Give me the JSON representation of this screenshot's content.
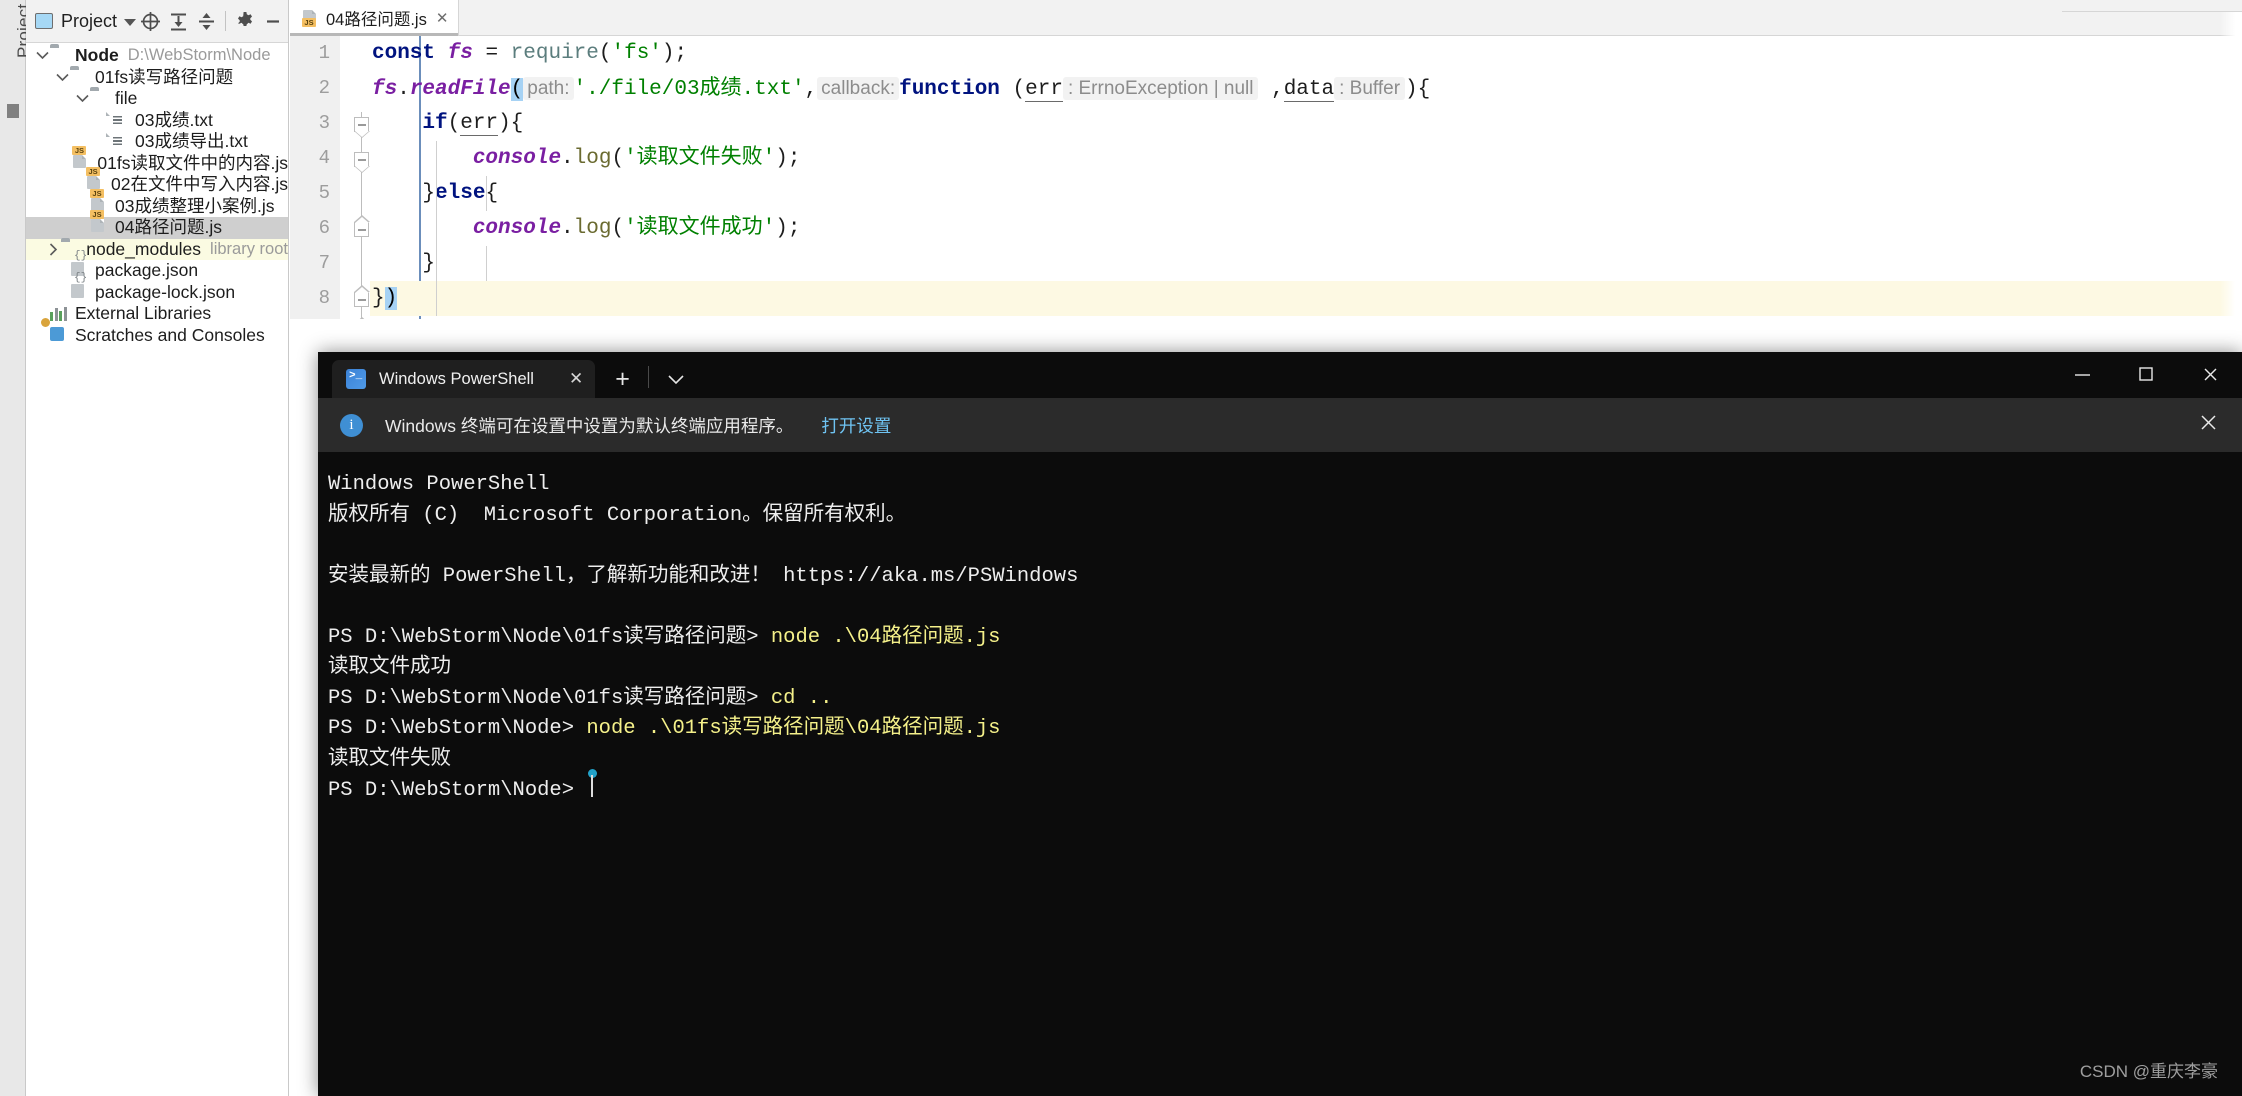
{
  "ide": {
    "vertical_tab_label": "Project",
    "project_panel": {
      "title": "Project",
      "toolbar": [
        {
          "name": "locate-icon",
          "glyph": "locate"
        },
        {
          "name": "expand-all-icon",
          "glyph": "expand-all"
        },
        {
          "name": "collapse-all-icon",
          "glyph": "collapse-all"
        },
        {
          "name": "gear-icon",
          "glyph": "gear"
        },
        {
          "name": "hide-icon",
          "glyph": "minus"
        }
      ],
      "tree": [
        {
          "label": "Node",
          "sub": "D:\\WebStorm\\Node",
          "icon": "folder",
          "twist": "down",
          "depth": 0,
          "bold": true,
          "state": "normal"
        },
        {
          "label": "01fs读写路径问题",
          "sub": "",
          "icon": "folder",
          "twist": "down",
          "depth": 1,
          "bold": false,
          "state": "normal"
        },
        {
          "label": "file",
          "sub": "",
          "icon": "folder",
          "twist": "down",
          "depth": 2,
          "bold": false,
          "state": "normal"
        },
        {
          "label": "03成绩.txt",
          "sub": "",
          "icon": "txt",
          "twist": "none",
          "depth": 3,
          "bold": false,
          "state": "normal"
        },
        {
          "label": "03成绩导出.txt",
          "sub": "",
          "icon": "txt",
          "twist": "none",
          "depth": 3,
          "bold": false,
          "state": "normal"
        },
        {
          "label": "01fs读取文件中的内容.js",
          "sub": "",
          "icon": "js",
          "twist": "none",
          "depth": 2,
          "bold": false,
          "state": "normal"
        },
        {
          "label": "02在文件中写入内容.js",
          "sub": "",
          "icon": "js",
          "twist": "none",
          "depth": 2,
          "bold": false,
          "state": "normal"
        },
        {
          "label": "03成绩整理小案例.js",
          "sub": "",
          "icon": "js",
          "twist": "none",
          "depth": 2,
          "bold": false,
          "state": "normal"
        },
        {
          "label": "04路径问题.js",
          "sub": "",
          "icon": "js",
          "twist": "none",
          "depth": 2,
          "bold": false,
          "state": "selected"
        },
        {
          "label": "node_modules",
          "sub": "library root",
          "icon": "folder",
          "twist": "right",
          "depth": 1,
          "bold": false,
          "state": "highlight"
        },
        {
          "label": "package.json",
          "sub": "",
          "icon": "json",
          "twist": "none",
          "depth": 1,
          "bold": false,
          "state": "normal"
        },
        {
          "label": "package-lock.json",
          "sub": "",
          "icon": "json",
          "twist": "none",
          "depth": 1,
          "bold": false,
          "state": "normal"
        },
        {
          "label": "External Libraries",
          "sub": "",
          "icon": "lib",
          "twist": "none",
          "depth": 0,
          "bold": false,
          "state": "normal"
        },
        {
          "label": "Scratches and Consoles",
          "sub": "",
          "icon": "scratch",
          "twist": "none",
          "depth": 0,
          "bold": false,
          "state": "normal"
        }
      ]
    },
    "editor": {
      "tab": {
        "label": "04路径问题.js",
        "close": "✕",
        "icon": "js-file-icon"
      },
      "line_numbers": [
        "1",
        "2",
        "3",
        "4",
        "5",
        "6",
        "7",
        "8"
      ],
      "code": {
        "l1": {
          "kw_const": "const",
          "var_fs": "fs",
          "eq": " = ",
          "require": "require",
          "open": "(",
          "str": "'fs'",
          "close": ");"
        },
        "l2": {
          "obj": "fs",
          "dot": ".",
          "method": "readFile",
          "paren_open": "(",
          "hint_path": "path:",
          "str_path": "'./file/03成绩.txt'",
          "comma": ",",
          "hint_callback": "callback:",
          "kw_function": "function",
          "sp_paren": " (",
          "param_err": "err",
          "type_err": ": ErrnoException | null",
          "comma2": " ,",
          "param_data": "data",
          "type_data": ": Buffer",
          "tail": "){"
        },
        "l3": {
          "kw_if": "if",
          "paren": "(",
          "param": "err",
          "close": "){"
        },
        "l4": {
          "obj": "console",
          "dot": ".",
          "method": "log",
          "open": "(",
          "str": "'读取文件失败'",
          "close": ");"
        },
        "l5": {
          "brace": "}",
          "kw_else": "else",
          "open": "{"
        },
        "l6": {
          "obj": "console",
          "dot": ".",
          "method": "log",
          "open": "(",
          "str": "'读取文件成功'",
          "close": ");"
        },
        "l7": {
          "brace": "}"
        },
        "l8": {
          "brace": "}",
          "paren": ")"
        }
      }
    }
  },
  "powershell": {
    "tab": {
      "title": "Windows PowerShell",
      "close_label": "✕"
    },
    "new_tab_label": "+",
    "dropdown_label": "⌄",
    "window_controls": {
      "minimize": "—",
      "maximize": "☐",
      "close": "✕"
    },
    "notice": {
      "text": "Windows 终端可在设置中设置为默认终端应用程序。",
      "link": "打开设置",
      "close": "✕"
    },
    "console_lines": [
      {
        "type": "plain",
        "text": "Windows PowerShell"
      },
      {
        "type": "plain",
        "text": "版权所有 (C)  Microsoft Corporation。保留所有权利。"
      },
      {
        "type": "blank",
        "text": ""
      },
      {
        "type": "plain",
        "text": "安装最新的 PowerShell，了解新功能和改进！ https://aka.ms/PSWindows"
      },
      {
        "type": "blank",
        "text": ""
      },
      {
        "type": "prompt",
        "prompt": "PS D:\\WebStorm\\Node\\01fs读写路径问题> ",
        "command": "node .\\04路径问题.js"
      },
      {
        "type": "plain",
        "text": "读取文件成功"
      },
      {
        "type": "prompt",
        "prompt": "PS D:\\WebStorm\\Node\\01fs读写路径问题> ",
        "command": "cd .."
      },
      {
        "type": "prompt",
        "prompt": "PS D:\\WebStorm\\Node> ",
        "command": "node .\\01fs读写路径问题\\04路径问题.js"
      },
      {
        "type": "plain",
        "text": "读取文件失败"
      },
      {
        "type": "cursor",
        "prompt": "PS D:\\WebStorm\\Node> ",
        "command": ""
      }
    ]
  },
  "watermark": "CSDN @重庆李豪"
}
